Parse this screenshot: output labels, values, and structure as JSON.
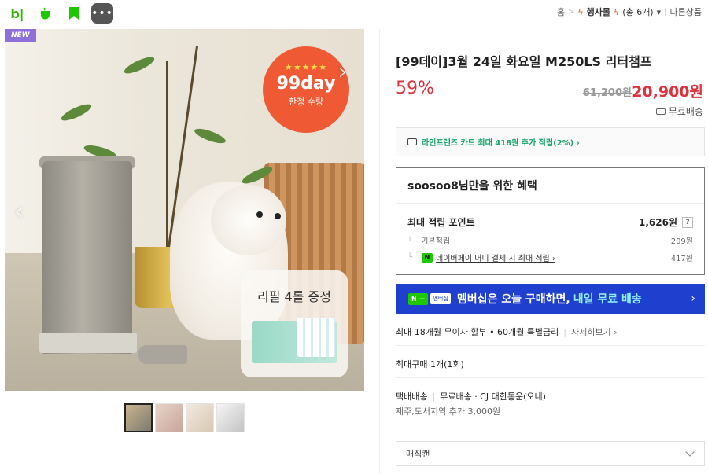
{
  "topbar": {
    "icons": [
      "blog-icon",
      "cafe-icon",
      "bookmark-icon",
      "more-icon"
    ],
    "icon_b": "b|",
    "icon_more": "•••",
    "breadcrumbs": {
      "home": "홈",
      "sep": ">",
      "event": "행사몰",
      "count": "(총 6개)",
      "next": "다른상품"
    }
  },
  "image": {
    "badge_new": "NEW",
    "promo_stars": "★★★★★",
    "promo_title": "99day",
    "promo_sub": "한정 수량",
    "gift_text": "리필 4롤 증정",
    "arrow_left": "‹",
    "arrow_right": "›"
  },
  "product": {
    "title": "[99데이]3월 24일 화요일 M250LS 리터챔프",
    "discount": "59%",
    "original_price": "61,200원",
    "price": "20,900원",
    "shipping_badge": "무료배송",
    "card_offer": "라인프렌즈 카드 최대 418원 추가 적립(2%) ›"
  },
  "benefit": {
    "title": "soosoo8님만을 위한 혜택",
    "max_points_label": "최대 적립 포인트",
    "max_points_value": "1,626원",
    "q": "?",
    "basic_label": "기본적립",
    "basic_value": "209원",
    "npay_icon": "N",
    "npay_label": "네이버페이 머니 결제 시 최대 적립 ›",
    "npay_value": "417원"
  },
  "membership": {
    "badge1": "N ＋",
    "badge2": "멤버십",
    "text": "멤버십은 오늘 구매하면,",
    "highlight": "내일 무료 배송",
    "arrow": "›"
  },
  "installment": {
    "text": "최대 18개월 무이자 할부 • 60개월 특별금리",
    "link": "자세히보기 ›"
  },
  "purchase_limit": "최대구매 1개(1회)",
  "delivery": {
    "type": "택배배송",
    "fee": "무료배송",
    "carrier": "· CJ 대한통운(오네)",
    "extra": "제주,도서지역 추가 3,000원"
  },
  "option_select": "매직캔",
  "colors": {
    "price_red": "#e0323d",
    "naver_green": "#1ec800",
    "membership_blue": "#1f3fcf"
  }
}
